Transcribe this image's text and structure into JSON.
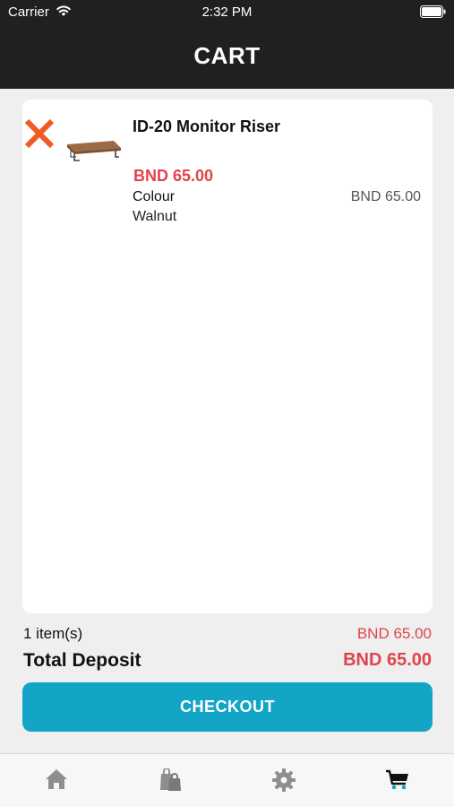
{
  "status_bar": {
    "carrier": "Carrier",
    "time": "2:32 PM"
  },
  "header": {
    "title": "CART"
  },
  "cart": {
    "items": [
      {
        "name": "ID-20 Monitor Riser",
        "price": "BND 65.00",
        "option_label": "Colour",
        "option_value": "Walnut",
        "option_price": "BND 65.00"
      }
    ]
  },
  "summary": {
    "item_count": "1 item(s)",
    "subtotal": "BND 65.00",
    "total_label": "Total Deposit",
    "total_value": "BND 65.00"
  },
  "checkout": {
    "label": "CHECKOUT"
  },
  "tab_bar": {
    "tabs": [
      {
        "icon": "home-icon",
        "active": false
      },
      {
        "icon": "shopping-bags-icon",
        "active": false
      },
      {
        "icon": "gear-icon",
        "active": false
      },
      {
        "icon": "cart-icon",
        "active": true
      }
    ]
  },
  "colors": {
    "accent": "#12a5c6",
    "price": "#e0444c",
    "remove": "#f05a23",
    "header": "#202020",
    "tab_inactive": "#8e8e8e",
    "tab_active": "#111111",
    "tab_active_highlight": "#12a5c6"
  }
}
